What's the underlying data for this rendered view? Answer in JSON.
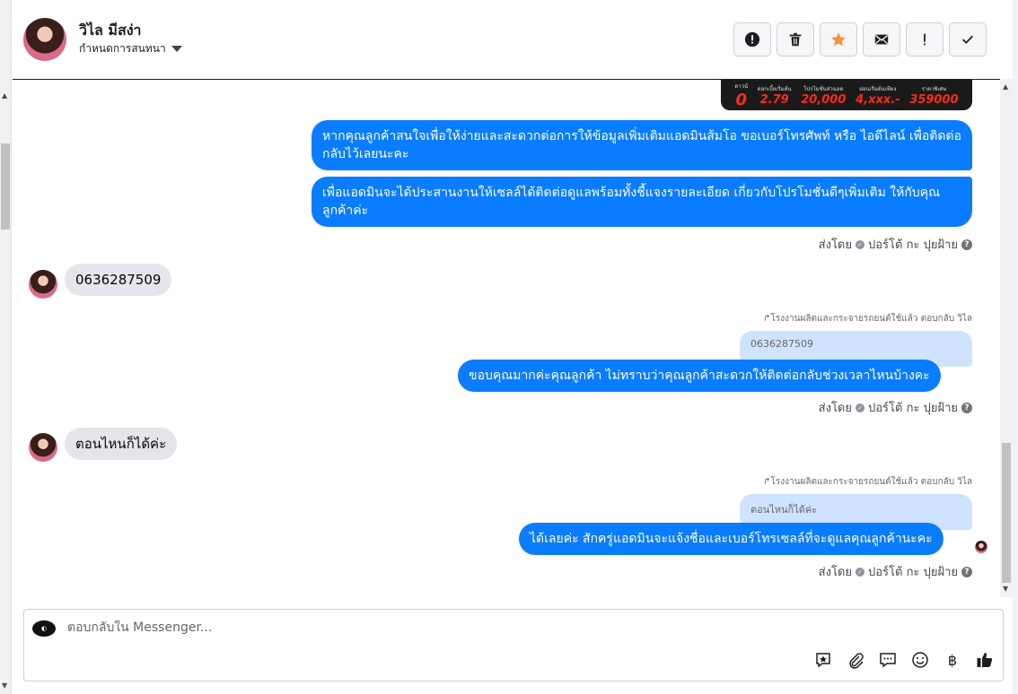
{
  "header": {
    "name": "วิไล มีสง่า",
    "subtitle": "กำหนดการสนทนา",
    "actions": [
      {
        "name": "mark-spam",
        "icon": "exclamation-circle-icon"
      },
      {
        "name": "delete",
        "icon": "trash-icon"
      },
      {
        "name": "star",
        "icon": "star-icon",
        "color": "#f7923b"
      },
      {
        "name": "mark-unread",
        "icon": "envelope-icon"
      },
      {
        "name": "mark-important",
        "icon": "exclamation-icon"
      },
      {
        "name": "mark-done",
        "icon": "checkmark-icon"
      }
    ]
  },
  "promo": {
    "items": [
      {
        "label": "ดาวน์",
        "value": "0"
      },
      {
        "label": "ดอกเบี้ยเริ่มต้น",
        "value": "2.79"
      },
      {
        "label": "โปรโมชั่นส่วนลด",
        "value": "20,000"
      },
      {
        "label": "ผ่อนเริ่มต้นเพียง",
        "value": "4,xxx.-"
      },
      {
        "label": "ราคาพิเศษ",
        "value": "359000"
      }
    ]
  },
  "messages": {
    "out1": "หากคุณลูกค้าสนใจเพื่อให้ง่ายและสะดวกต่อการให้ข้อมูลเพิ่มเติมแอดมินส้มโอ ขอเบอร์โทรศัพท์ หรือ ไอดีไลน์ เพื่อติดต่อกลับไว้เลยนะคะ",
    "out2": "เพื่อแอดมินจะได้ประสานงานให้เซลล์ได้ติดต่อดูแลพร้อมทั้งชี้แจงรายละเอียด เกี่ยวกับโปรโมชั่นดีๆเพิ่มเติม ให้กับคุณลูกค้าค่ะ",
    "meta1": "ส่งโดย",
    "meta1_author": "ปอร์โต้ กะ ปุยฝ้าย",
    "in1": "0636287509",
    "reply_note1": "โรงงานผลิตและกระจายรถยนต์ใช้แล้ว ตอบกลับ วิไล",
    "quote1": "0636287509",
    "out3": "ขอบคุณมากค่ะคุณลูกค้า ไม่ทราบว่าคุณลูกค้าสะดวกให้ติดต่อกลับช่วงเวลาไหนบ้างคะ",
    "meta2": "ส่งโดย",
    "meta2_author": "ปอร์โต้ กะ ปุยฝ้าย",
    "in2": "ตอนไหนก็ได้ค่ะ",
    "reply_note2": "โรงงานผลิตและกระจายรถยนต์ใช้แล้ว ตอบกลับ วิไล",
    "quote2": "ตอนไหนก็ได้ค่ะ",
    "out4": "ได้เลยค่ะ สักครู่แอดมินจะแจ้งชื่อและเบอร์โทรเซลล์ที่จะดูแลคุณลูกค้านะคะ",
    "meta3": "ส่งโดย",
    "meta3_author": "ปอร์โต้ กะ ปุยฝ้าย"
  },
  "composer": {
    "placeholder": "ตอบกลับใน Messenger...",
    "tools": [
      "saved-reply-icon",
      "attachment-icon",
      "message-icon",
      "emoji-icon",
      "baht-payment-icon",
      "like-icon"
    ]
  },
  "colors": {
    "outgoing": "#0a7cff",
    "incoming": "#e4e6eb",
    "quote": "#cfe3ff"
  }
}
